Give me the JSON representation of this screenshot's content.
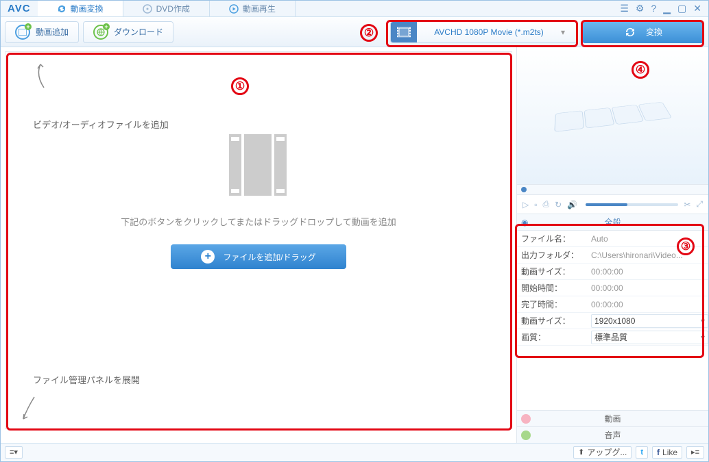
{
  "app": {
    "logo": "AVC"
  },
  "tabs": {
    "convert": "動画変換",
    "dvd": "DVD作成",
    "play": "動画再生"
  },
  "toolbar": {
    "add_video": "動画追加",
    "download": "ダウンロード",
    "format": "AVCHD 1080P Movie (*.m2ts)",
    "convert": "変換"
  },
  "drop": {
    "hint_add": "ビデオ/オーディオファイルを追加",
    "instruction": "下記のボタンをクリックしてまたはドラッグドロップして動画を追加",
    "button": "ファイルを追加/ドラッグ",
    "hint_expand": "ファイル管理パネルを展開"
  },
  "general": {
    "title": "全般",
    "filename_l": "ファイル名：",
    "filename_v": "Auto",
    "outfolder_l": "出力フォルダ：",
    "outfolder_v": "C:\\Users\\hironari\\Video...",
    "duration_l": "動画サイズ：",
    "duration_v": "00:00:00",
    "start_l": "開始時間：",
    "start_v": "00:00:00",
    "end_l": "完了時間：",
    "end_v": "00:00:00",
    "size_l": "動画サイズ：",
    "size_v": "1920x1080",
    "quality_l": "画質：",
    "quality_v": "標準品質"
  },
  "cats": {
    "video": "動画",
    "audio": "音声"
  },
  "status": {
    "upgrade": "アップグ...",
    "like": "Like"
  }
}
